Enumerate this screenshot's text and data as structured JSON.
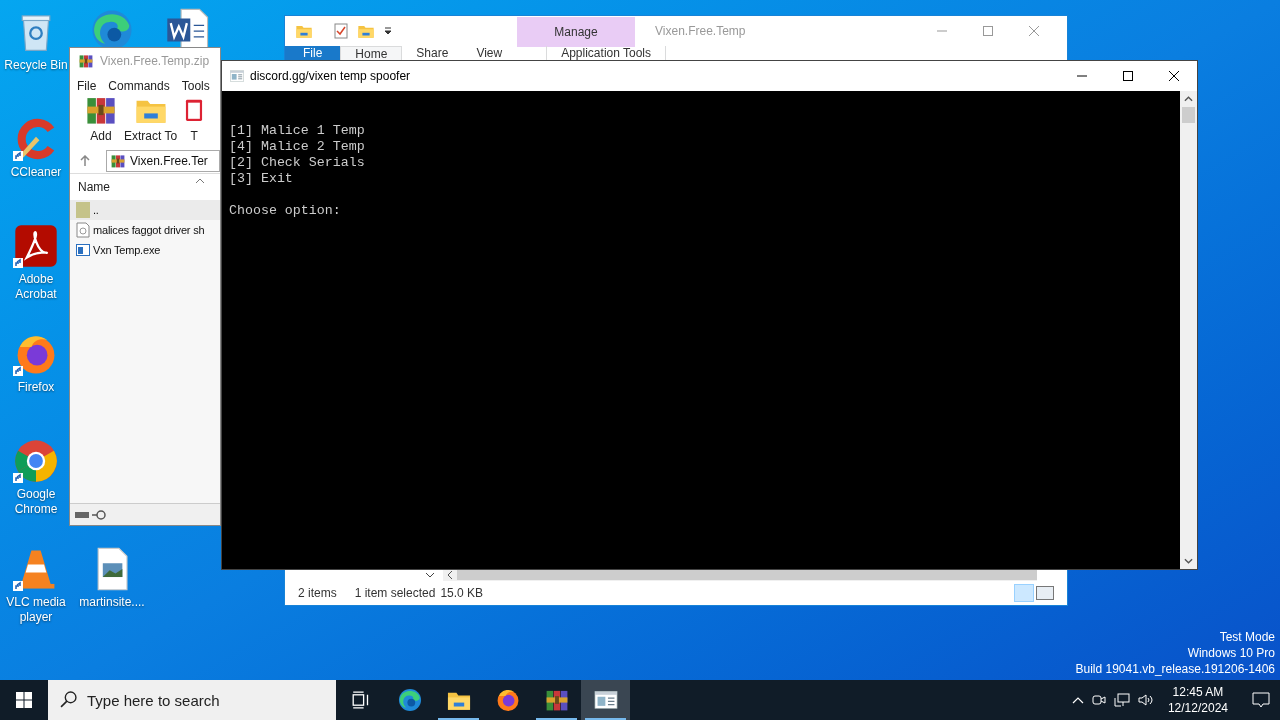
{
  "desktop": {
    "icons": [
      {
        "kind": "recycle-bin",
        "label": "Recycle Bin",
        "shortcut": false
      },
      {
        "kind": "ccleaner",
        "label": "CCleaner",
        "shortcut": true
      },
      {
        "kind": "acrobat",
        "label": "Adobe Acrobat",
        "shortcut": true
      },
      {
        "kind": "firefox",
        "label": "Firefox",
        "shortcut": true
      },
      {
        "kind": "chrome",
        "label": "Google Chrome",
        "shortcut": true
      },
      {
        "kind": "vlc",
        "label": "VLC media player",
        "shortcut": true
      },
      {
        "kind": "image-file",
        "label": "martinsite....",
        "shortcut": false
      },
      {
        "kind": "edge"
      },
      {
        "kind": "word"
      }
    ]
  },
  "explorer": {
    "title": "Vixen.Free.Temp",
    "context_tab": "Manage",
    "context_group": "Application Tools",
    "tabs": [
      {
        "label": "File",
        "selected": false
      },
      {
        "label": "Home",
        "selected": true
      },
      {
        "label": "Share",
        "selected": false
      },
      {
        "label": "View",
        "selected": false
      }
    ],
    "status": {
      "count": "2 items",
      "selection": "1 item selected",
      "size": "15.0 KB"
    }
  },
  "winrar": {
    "title": "Vixen.Free.Temp.zip",
    "menu": [
      "File",
      "Commands",
      "Tools"
    ],
    "toolbar": [
      {
        "kind": "add",
        "label": "Add"
      },
      {
        "kind": "extract",
        "label": "Extract To"
      },
      {
        "kind": "test",
        "label": "T"
      }
    ],
    "address": "Vixen.Free.Ter",
    "column": "Name",
    "files": [
      {
        "kind": "parent",
        "name": "..",
        "selected": true
      },
      {
        "kind": "document",
        "name": "malices faggot driver sh",
        "selected": false
      },
      {
        "kind": "exe",
        "name": "Vxn Temp.exe",
        "selected": false
      }
    ]
  },
  "console": {
    "title": "discord.gg/vixen temp spoofer",
    "menu_lines": [
      "[1] Malice 1 Temp",
      "[4] Malice 2 Temp",
      "[2] Check Serials",
      "[3] Exit"
    ],
    "prompt": "Choose option:"
  },
  "system_notice": [
    "Test Mode",
    "Windows 10 Pro",
    "Build 19041.vb_release.191206-1406"
  ],
  "taskbar": {
    "search": {
      "placeholder": "Type here to search"
    },
    "apps": [
      {
        "kind": "task-view",
        "running": false,
        "active": false
      },
      {
        "kind": "edge",
        "running": false,
        "active": false
      },
      {
        "kind": "explorer",
        "running": true,
        "active": false
      },
      {
        "kind": "firefox",
        "running": false,
        "active": false
      },
      {
        "kind": "winrar",
        "running": true,
        "active": false
      },
      {
        "kind": "console",
        "running": true,
        "active": true
      }
    ],
    "time": "12:45 AM",
    "date": "12/12/2024"
  }
}
